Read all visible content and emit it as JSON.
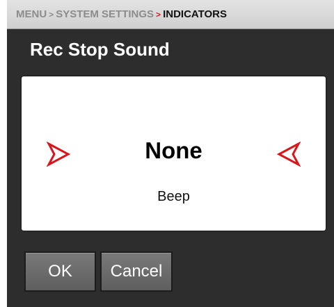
{
  "breadcrumb": {
    "items": [
      "MENU",
      "SYSTEM SETTINGS",
      "INDICATORS"
    ],
    "separator": ">"
  },
  "dialog": {
    "title": "Rec Stop Sound",
    "selected_value": "None",
    "next_value": "Beep",
    "prev_arrow_icon": "chevron-right-outline-icon",
    "next_arrow_icon": "chevron-left-outline-icon"
  },
  "buttons": {
    "ok_label": "OK",
    "cancel_label": "Cancel"
  },
  "colors": {
    "accent": "#d8161c",
    "background": "#2d2d2d",
    "button": "#6b6b6b",
    "panel": "#ffffff"
  }
}
